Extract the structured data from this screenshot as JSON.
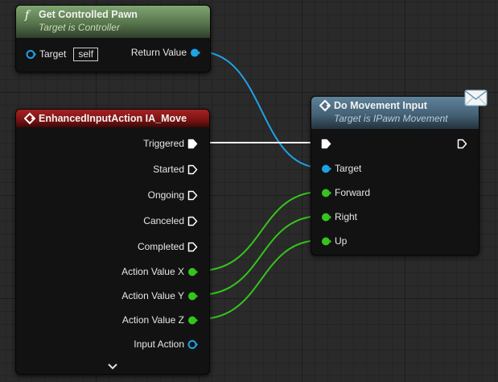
{
  "colors": {
    "exec": "#ffffff",
    "object": "#1da2e6",
    "float": "#35c51d",
    "pure_header": "#6b8f5e",
    "event_header": "#8e1616",
    "call_header": "#4f6e82"
  },
  "node_get_pawn": {
    "icon": "function-icon",
    "title": "Get Controlled Pawn",
    "subtitle": "Target is Controller",
    "input_pin": "Target",
    "input_value": "self",
    "output_pin": "Return Value"
  },
  "node_event": {
    "icon": "event-diamond-icon",
    "title": "EnhancedInputAction IA_Move",
    "pins": [
      "Triggered",
      "Started",
      "Ongoing",
      "Canceled",
      "Completed",
      "Action Value X",
      "Action Value Y",
      "Action Value Z",
      "Input Action"
    ],
    "expand_icon": "chevron-down-icon"
  },
  "node_movement": {
    "icon": "function-call-icon",
    "title": "Do Movement Input",
    "subtitle": "Target is IPawn Movement",
    "pins": [
      "Target",
      "Forward",
      "Right",
      "Up"
    ],
    "badge_icon": "message-envelope-icon"
  }
}
